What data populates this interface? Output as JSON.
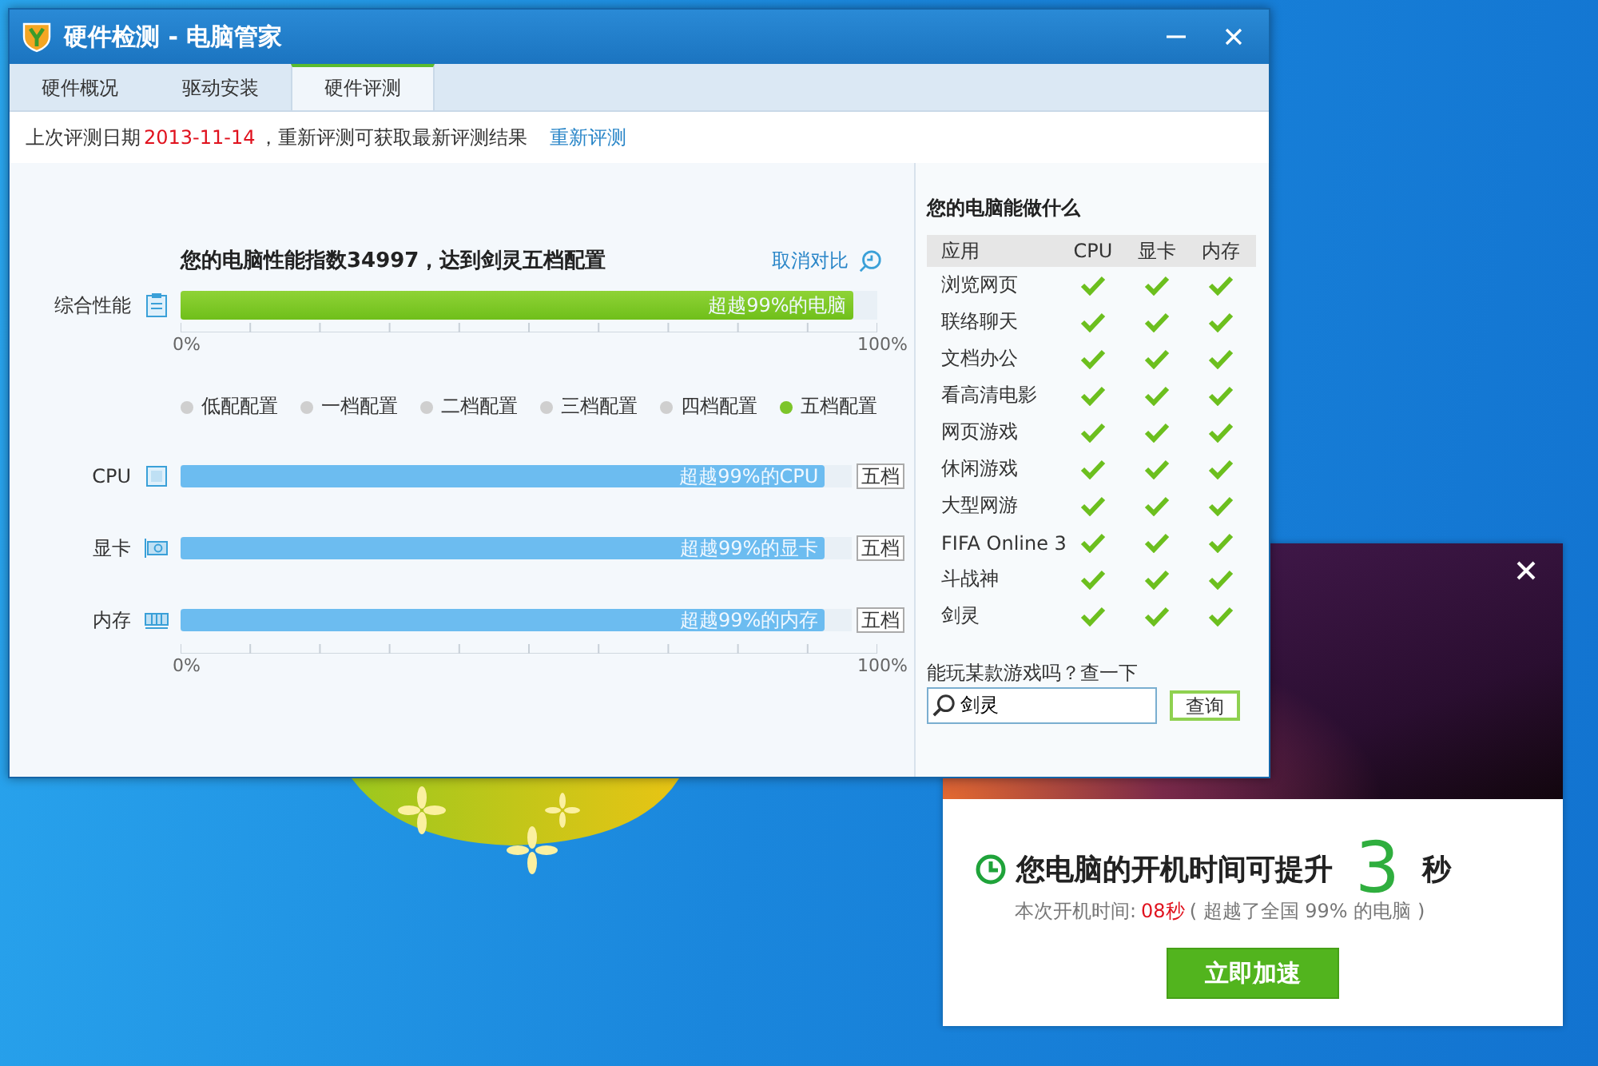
{
  "window": {
    "title": "硬件检测 - 电脑管家"
  },
  "tabs": [
    {
      "label": "硬件概况",
      "selected": false
    },
    {
      "label": "驱动安装",
      "selected": false
    },
    {
      "label": "硬件评测",
      "selected": true
    }
  ],
  "last_test": {
    "prefix": "上次评测日期",
    "date": "2013-11-14",
    "suffix": "，重新评测可获取最新评测结果",
    "link": "重新评测"
  },
  "score": {
    "headline": "您的电脑性能指数**34997**，达到剑灵**五档配置**",
    "compare_link": "取消对比"
  },
  "overall": {
    "label": "综合性能",
    "level": 0.965,
    "bar_text": "超越99%的电脑",
    "axis_min": "0%",
    "axis_max": "100%"
  },
  "legend": [
    {
      "label": "低配配置",
      "selected": false
    },
    {
      "label": "一档配置",
      "selected": false
    },
    {
      "label": "二档配置",
      "selected": false
    },
    {
      "label": "三档配置",
      "selected": false
    },
    {
      "label": "四档配置",
      "selected": false
    },
    {
      "label": "五档配置",
      "selected": true
    }
  ],
  "components": [
    {
      "kind": "cpu",
      "label": "CPU",
      "level": 0.96,
      "bar_text": "超越99%的CPU",
      "tier": "五档"
    },
    {
      "kind": "gpu",
      "label": "显卡",
      "level": 0.96,
      "bar_text": "超越99%的显卡",
      "tier": "五档"
    },
    {
      "kind": "memory",
      "label": "内存",
      "level": 0.96,
      "bar_text": "超越99%的内存",
      "tier": "五档"
    }
  ],
  "components_axis": {
    "min": "0%",
    "max": "100%"
  },
  "capability": {
    "title": "您的电脑能做什么",
    "columns": [
      "应用",
      "CPU",
      "显卡",
      "内存"
    ],
    "rows": [
      {
        "app": "浏览网页",
        "checks": [
          true,
          true,
          true
        ]
      },
      {
        "app": "联络聊天",
        "checks": [
          true,
          true,
          true
        ]
      },
      {
        "app": "文档办公",
        "checks": [
          true,
          true,
          true
        ]
      },
      {
        "app": "看高清电影",
        "checks": [
          true,
          true,
          true
        ]
      },
      {
        "app": "网页游戏",
        "checks": [
          true,
          true,
          true
        ]
      },
      {
        "app": "休闲游戏",
        "checks": [
          true,
          true,
          true
        ]
      },
      {
        "app": "大型网游",
        "checks": [
          true,
          true,
          true
        ]
      },
      {
        "app": "FIFA Online 3",
        "checks": [
          true,
          true,
          true
        ]
      },
      {
        "app": "斗战神",
        "checks": [
          true,
          true,
          true
        ]
      },
      {
        "app": "剑灵",
        "checks": [
          true,
          true,
          true
        ]
      }
    ]
  },
  "game_search": {
    "label": "能玩某款游戏吗？查一下",
    "value": "剑灵",
    "button": "查询"
  },
  "popup": {
    "headline": "您电脑的开机时间可提升",
    "seconds": "3",
    "unit": "秒",
    "detail_prefix": "本次开机时间:",
    "detail_time": "08秒",
    "detail_suffix": "( 超越了全国 99% 的电脑 )",
    "button": "立即加速"
  }
}
